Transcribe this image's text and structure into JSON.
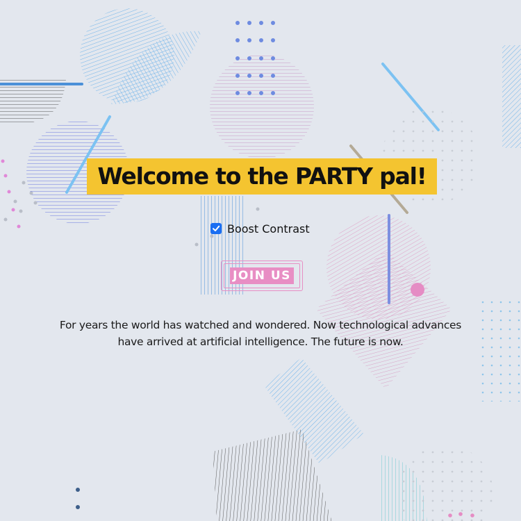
{
  "headline": "Welcome to the PARTY pal!",
  "boost_contrast": {
    "label": "Boost Contrast",
    "checked": true
  },
  "join_button": {
    "label": "JOIN US"
  },
  "tagline": "For years the world has watched and wondered. Now technological advances have arrived at artificial intelligence. The future is now.",
  "colors": {
    "background": "#e3e7ee",
    "headline_highlight": "#f4c430",
    "checkbox": "#1a6ef2",
    "button_accent": "#e88ec4"
  }
}
